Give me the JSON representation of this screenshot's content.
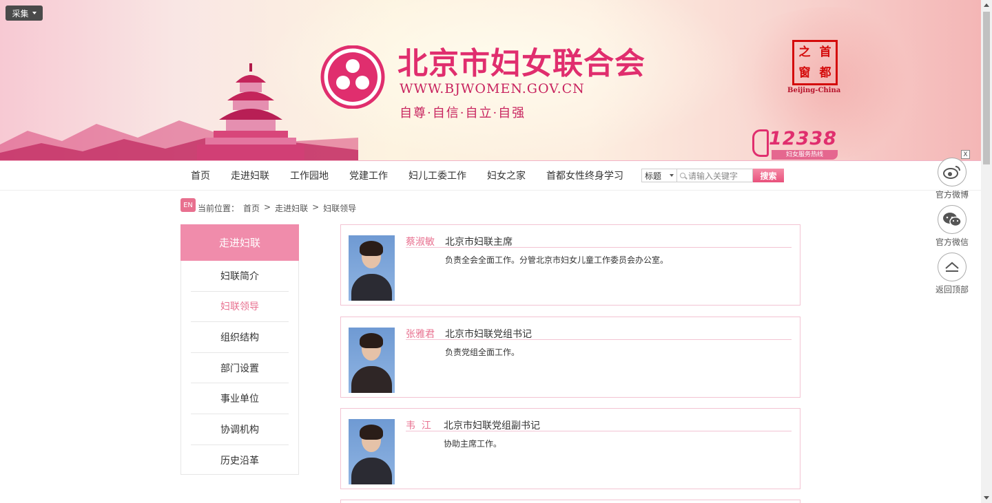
{
  "toolbar": {
    "caiji_label": "采集"
  },
  "header": {
    "title": "北京市妇女联合会",
    "url": "WWW.BJWOMEN.GOV.CN",
    "slogan": "自尊·自信·自立·自强",
    "seal": {
      "chars": [
        "首",
        "之",
        "都",
        "窗"
      ],
      "caption": "Beijing-China"
    },
    "hotline": {
      "number": "12338",
      "caption": "妇女服务热线"
    }
  },
  "nav": {
    "items": [
      "首页",
      "走进妇联",
      "工作园地",
      "党建工作",
      "妇儿工委工作",
      "妇女之家",
      "首都女性终身学习"
    ]
  },
  "search": {
    "select_value": "标题",
    "placeholder": "请输入关键字",
    "button_label": "搜索"
  },
  "breadcrumb": {
    "en_label": "EN",
    "prefix": "当前位置：",
    "items": [
      "首页",
      "走进妇联",
      "妇联领导"
    ],
    "sep": ">"
  },
  "sidebar": {
    "heading": "走进妇联",
    "items": [
      "妇联简介",
      "妇联领导",
      "组织结构",
      "部门设置",
      "事业单位",
      "协调机构",
      "历史沿革"
    ],
    "active_index": 1
  },
  "leaders": [
    {
      "name": "蔡淑敏",
      "title": "北京市妇联主席",
      "desc": "负责全会全面工作。分管北京市妇女儿童工作委员会办公室。"
    },
    {
      "name": "张雅君",
      "title": "北京市妇联党组书记",
      "desc": "负责党组全面工作。"
    },
    {
      "name": "韦  江",
      "title": "北京市妇联党组副书记",
      "desc": "协助主席工作。"
    }
  ],
  "float_bar": {
    "close_label": "X",
    "items": [
      {
        "label": "官方微博",
        "icon": "weibo-icon"
      },
      {
        "label": "官方微信",
        "icon": "wechat-icon"
      },
      {
        "label": "返回顶部",
        "icon": "back-to-top-icon"
      }
    ]
  },
  "colors": {
    "brand": "#e02e6e",
    "accent": "#f08cab",
    "active": "#e8708f"
  }
}
